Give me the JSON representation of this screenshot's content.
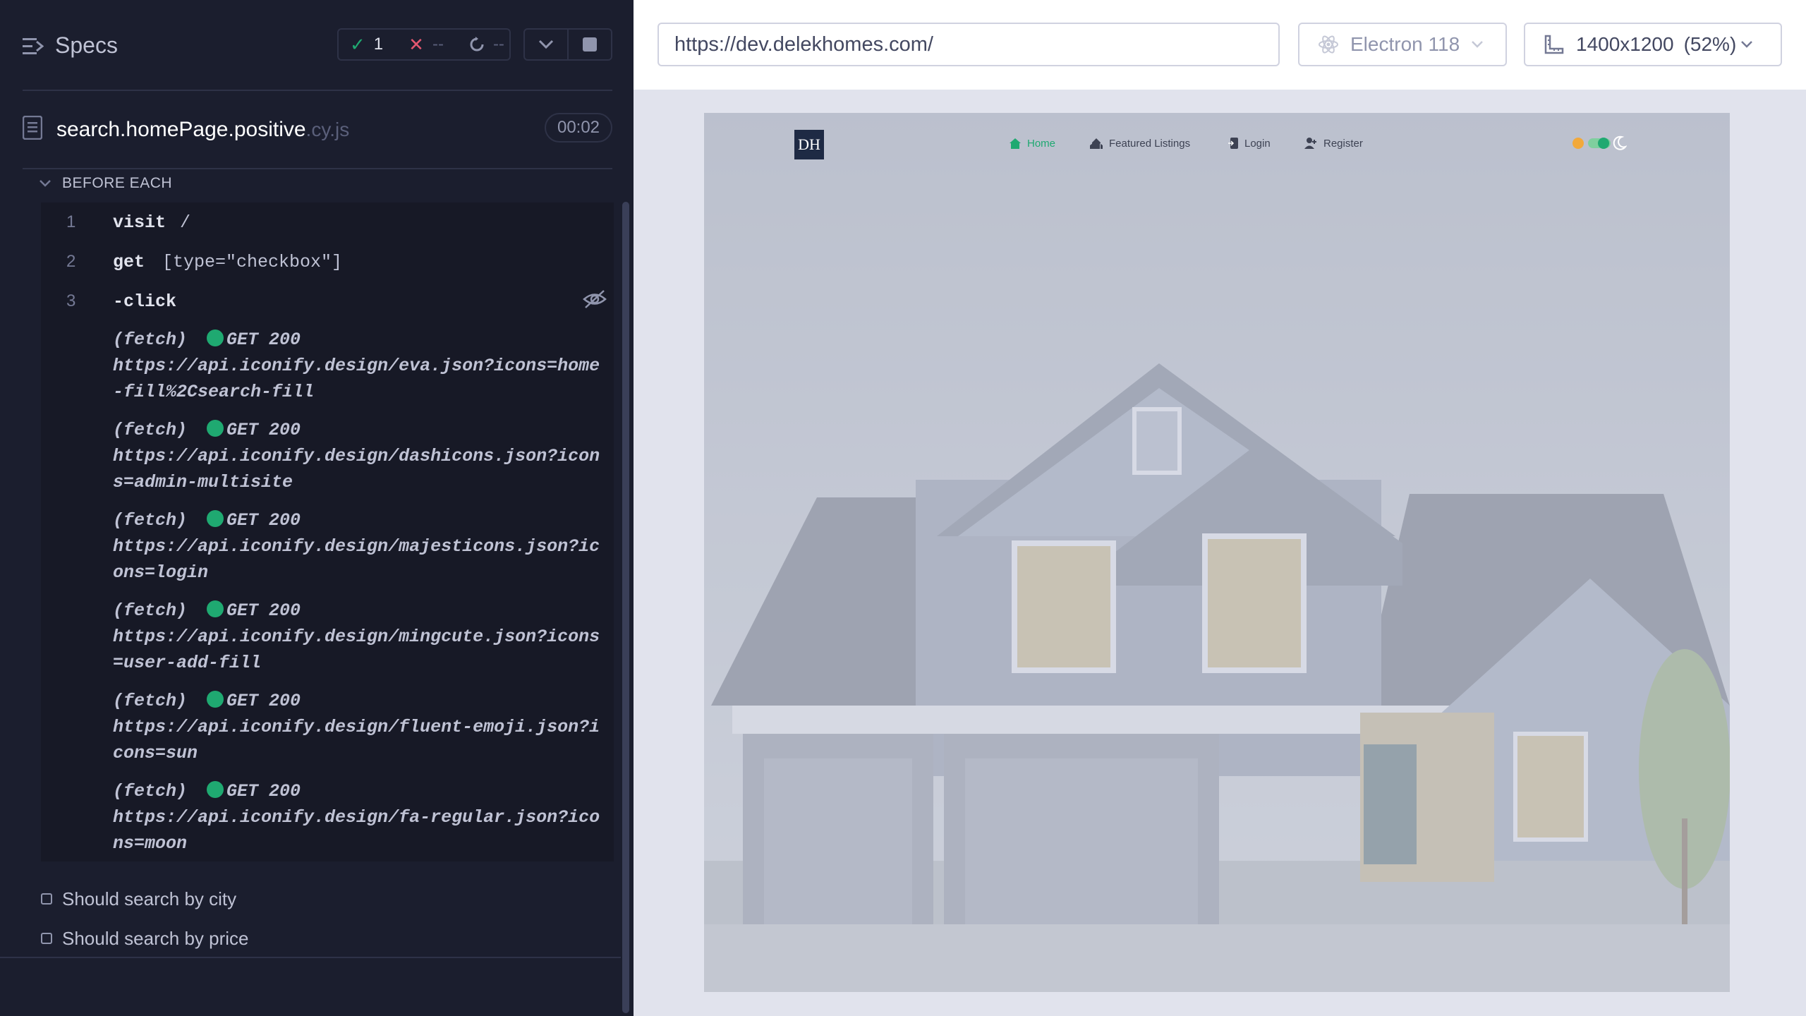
{
  "specs_panel": {
    "title": "Specs",
    "stats": {
      "passed": "1",
      "failed": "--",
      "pending": "--"
    },
    "spec_file": {
      "name": "search.homePage.positive",
      "ext": ".cy.js",
      "duration": "00:02"
    },
    "hook_title": "BEFORE EACH",
    "commands": [
      {
        "num": "1",
        "name": "visit",
        "message": "/"
      },
      {
        "num": "2",
        "name": "get",
        "message": "[type=\"checkbox\"]"
      },
      {
        "num": "3",
        "name": "-click",
        "message": ""
      }
    ],
    "logs": [
      {
        "type": "(fetch)",
        "status": "GET 200",
        "url": "https://api.iconify.design/eva.json?icons=home-fill%2Csearch-fill"
      },
      {
        "type": "(fetch)",
        "status": "GET 200",
        "url": "https://api.iconify.design/dashicons.json?icons=admin-multisite"
      },
      {
        "type": "(fetch)",
        "status": "GET 200",
        "url": "https://api.iconify.design/majesticons.json?icons=login"
      },
      {
        "type": "(fetch)",
        "status": "GET 200",
        "url": "https://api.iconify.design/mingcute.json?icons=user-add-fill"
      },
      {
        "type": "(fetch)",
        "status": "GET 200",
        "url": "https://api.iconify.design/fluent-emoji.json?icons=sun"
      },
      {
        "type": "(fetch)",
        "status": "GET 200",
        "url": "https://api.iconify.design/fa-regular.json?icons=moon"
      }
    ],
    "tests": [
      "Should search by city",
      "Should search by price"
    ]
  },
  "toolbar": {
    "url": "https://dev.delekhomes.com/",
    "browser": "Electron 118",
    "viewport": "1400x1200",
    "scale": "(52%)"
  },
  "site": {
    "logo": "DH",
    "nav": [
      "Home",
      "Featured Listings",
      "Login",
      "Register"
    ]
  },
  "colors": {
    "pass": "#1fa971",
    "fail": "#e45770",
    "accent": "#1fa971"
  }
}
